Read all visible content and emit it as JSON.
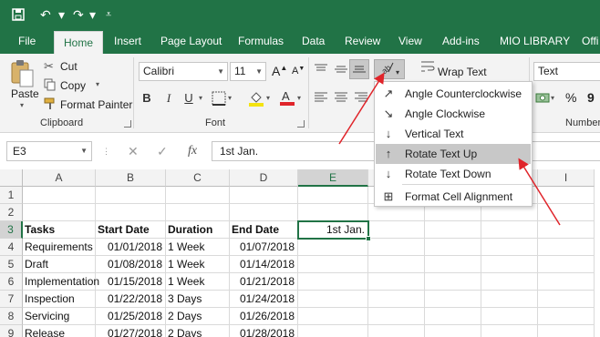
{
  "qat": {
    "save_icon": "save-icon",
    "undo_icon": "undo-icon",
    "redo_icon": "redo-icon",
    "customize_icon": "customize-qat-icon"
  },
  "tabs": [
    {
      "label": "File"
    },
    {
      "label": "Home",
      "active": true
    },
    {
      "label": "Insert"
    },
    {
      "label": "Page Layout"
    },
    {
      "label": "Formulas"
    },
    {
      "label": "Data"
    },
    {
      "label": "Review"
    },
    {
      "label": "View"
    },
    {
      "label": "Add-ins"
    },
    {
      "label": "MIO LIBRARY"
    },
    {
      "label": "Offi"
    }
  ],
  "clipboard": {
    "paste": "Paste",
    "cut": "Cut",
    "copy": "Copy",
    "format_painter": "Format Painter",
    "group": "Clipboard"
  },
  "font": {
    "name": "Calibri",
    "size": "11",
    "bold": "B",
    "italic": "I",
    "underline": "U",
    "grow": "A",
    "shrink": "A",
    "group": "Font"
  },
  "alignment": {
    "wrap_text": "Wrap Text"
  },
  "number": {
    "format": "Text",
    "percent": "%",
    "comma": "9",
    "group": "Number"
  },
  "formula_bar": {
    "name_box": "E3",
    "cancel": "✕",
    "enter": "✓",
    "fx": "fx",
    "value": "1st Jan."
  },
  "orientation_menu": [
    {
      "label": "Angle Counterclockwise",
      "icon": "angle-counterclockwise-icon"
    },
    {
      "label": "Angle Clockwise",
      "icon": "angle-clockwise-icon"
    },
    {
      "label": "Vertical Text",
      "icon": "vertical-text-icon"
    },
    {
      "label": "Rotate Text Up",
      "icon": "rotate-text-up-icon",
      "highlighted": true
    },
    {
      "label": "Rotate Text Down",
      "icon": "rotate-text-down-icon"
    },
    {
      "label": "Format Cell Alignment",
      "icon": "format-cell-alignment-icon"
    }
  ],
  "sheet": {
    "columns": [
      "A",
      "B",
      "C",
      "D",
      "E",
      "F",
      "G",
      "H",
      "I"
    ],
    "rows": [
      "1",
      "2",
      "3",
      "4",
      "5",
      "6",
      "7",
      "8",
      "9"
    ],
    "selected_cell": "E3",
    "headers": [
      "Tasks",
      "Start Date",
      "Duration",
      "End Date",
      "1st Jan."
    ],
    "data": [
      [
        "Requirements",
        "01/01/2018",
        "1 Week",
        "01/07/2018"
      ],
      [
        "Draft",
        "01/08/2018",
        "1 Week",
        "01/14/2018"
      ],
      [
        "Implementation",
        "01/15/2018",
        "1 Week",
        "01/21/2018"
      ],
      [
        "Inspection",
        "01/22/2018",
        "3 Days",
        "01/24/2018"
      ],
      [
        "Servicing",
        "01/25/2018",
        "2 Days",
        "01/26/2018"
      ],
      [
        "Release",
        "01/27/2018",
        "2 Days",
        "01/28/2018"
      ]
    ]
  },
  "colors": {
    "excel_green": "#217346",
    "annotation_arrow": "#e0242a"
  }
}
